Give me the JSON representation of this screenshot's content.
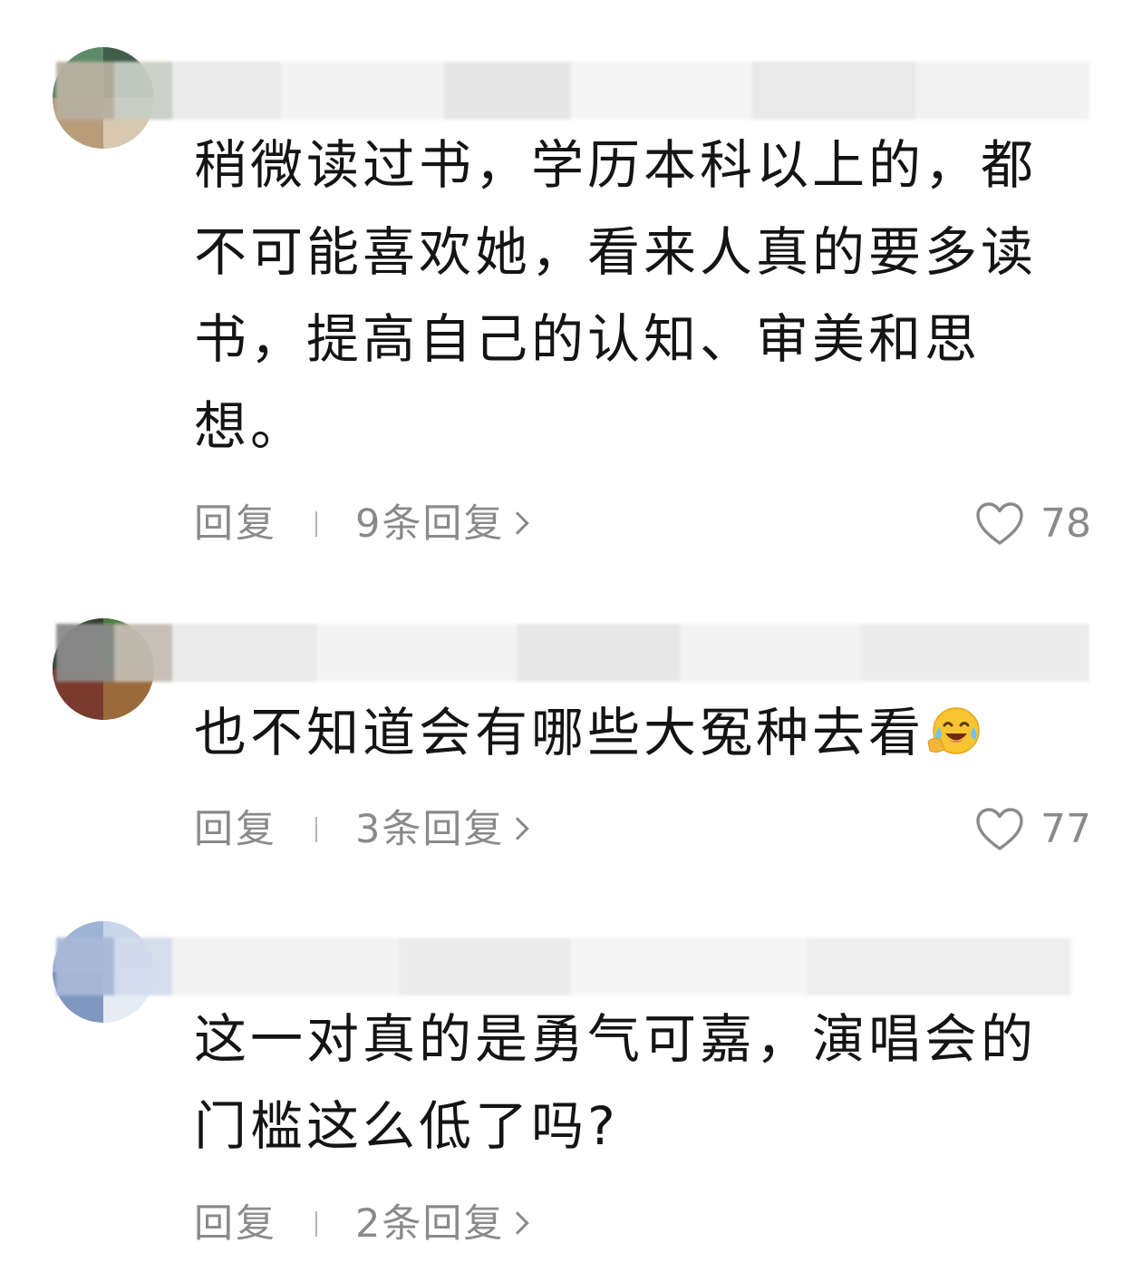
{
  "comments": [
    {
      "text": "稍微读过书，学历本科以上的，都不可能喜欢她，看来人真的要多读书，提高自己的认知、审美和思想。",
      "reply_label": "回复",
      "replies_label": "9条回复",
      "likes": "78",
      "avatar_colors": [
        "#5f8a6a",
        "#b99c7a",
        "#3f5e4a",
        "#d8c8b0"
      ]
    },
    {
      "text": "也不知道会有哪些大冤种去看",
      "emoji": "laughing-tears-emoji",
      "reply_label": "回复",
      "replies_label": "3条回复",
      "likes": "77",
      "avatar_colors": [
        "#7a3a2e",
        "#4e7a3c",
        "#9b6a3a",
        "#2f3f2a"
      ]
    },
    {
      "text": "这一对真的是勇气可嘉，演唱会的门槛这么低了吗?",
      "reply_label": "回复",
      "replies_label": "2条回复",
      "likes": "",
      "avatar_colors": [
        "#9db3d6",
        "#c8d5ea",
        "#7f97bf",
        "#e6ecf5"
      ]
    }
  ],
  "icons": {
    "like": "heart-outline-icon",
    "chevron": "chevron-right-icon"
  },
  "colors": {
    "text": "#141414",
    "meta": "#8a8a8a",
    "background": "#ffffff"
  }
}
